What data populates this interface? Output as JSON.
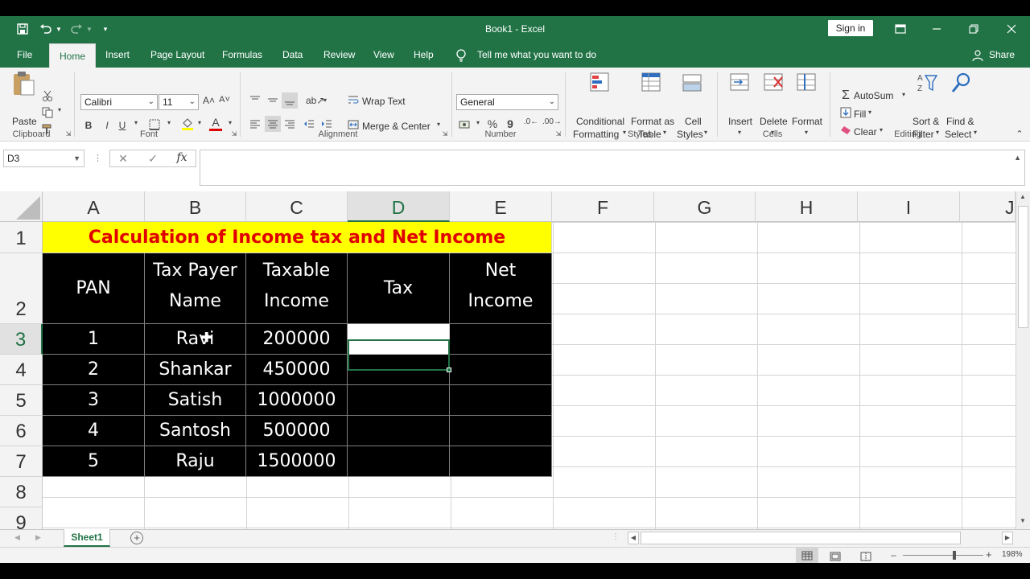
{
  "app": {
    "doc_title": "Book1  -  Excel",
    "signin_label": "Sign in",
    "share_label": "Share",
    "tell_me": "Tell me what you want to do"
  },
  "menu": [
    {
      "label": "File",
      "active": false
    },
    {
      "label": "Home",
      "active": true
    },
    {
      "label": "Insert",
      "active": false
    },
    {
      "label": "Page Layout",
      "active": false
    },
    {
      "label": "Formulas",
      "active": false
    },
    {
      "label": "Data",
      "active": false
    },
    {
      "label": "Review",
      "active": false
    },
    {
      "label": "View",
      "active": false
    },
    {
      "label": "Help",
      "active": false
    }
  ],
  "ribbon": {
    "paste": "Paste",
    "clipboard_group": "Clipboard",
    "font_name": "Calibri",
    "font_size": "11",
    "font_group": "Font",
    "bold": "B",
    "italic": "I",
    "underline": "U",
    "wrap_text": "Wrap Text",
    "merge_center": "Merge & Center",
    "alignment_group": "Alignment",
    "number_format": "General",
    "number_group": "Number",
    "percent": "%",
    "comma": "9",
    "conditional_1": "Conditional",
    "conditional_2": "Formatting",
    "format_table_1": "Format as",
    "format_table_2": "Table",
    "cell_styles_1": "Cell",
    "cell_styles_2": "Styles",
    "styles_group": "Styles",
    "insert": "Insert",
    "delete": "Delete",
    "format": "Format",
    "cells_group": "Cells",
    "autosum": "AutoSum",
    "fill": "Fill",
    "clear": "Clear",
    "sort_1": "Sort &",
    "sort_2": "Filter",
    "find_1": "Find &",
    "find_2": "Select",
    "editing_group": "Editing"
  },
  "formula_bar": {
    "name_box": "D3",
    "fx": "fx",
    "formula": ""
  },
  "columns": [
    "A",
    "B",
    "C",
    "D",
    "E",
    "F",
    "G",
    "H",
    "I",
    "J"
  ],
  "rows": [
    "1",
    "2",
    "3",
    "4",
    "5",
    "6",
    "7",
    "8",
    "9"
  ],
  "selected_cell": "D3",
  "sheet": {
    "title": "Calculation of Income tax and Net Income",
    "headers": [
      "PAN",
      "Tax Payer Name",
      "Taxable Income",
      "Tax",
      "Net Income"
    ],
    "data": [
      [
        "1",
        "Ravi",
        "200000",
        "",
        ""
      ],
      [
        "2",
        "Shankar",
        "450000",
        "",
        ""
      ],
      [
        "3",
        "Satish",
        "1000000",
        "",
        ""
      ],
      [
        "4",
        "Santosh",
        "500000",
        "",
        ""
      ],
      [
        "5",
        "Raju",
        "1500000",
        "",
        ""
      ]
    ]
  },
  "tabs": [
    {
      "label": "Sheet1",
      "active": true
    }
  ],
  "status": {
    "zoom": "198%"
  },
  "colors": {
    "excel_green": "#217346",
    "title_fill": "#ffff00",
    "title_text": "#e00000",
    "table_fill": "#000000",
    "table_text": "#ffffff"
  }
}
